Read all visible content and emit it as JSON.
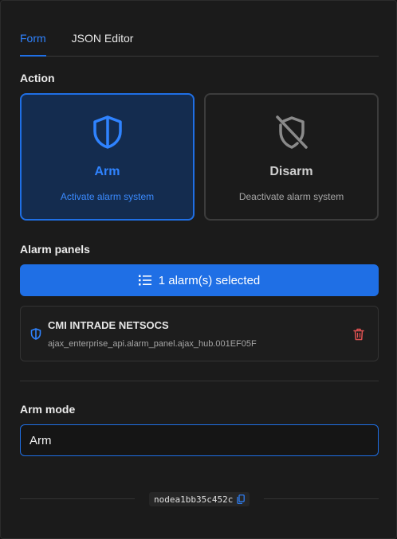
{
  "tabs": [
    {
      "label": "Form",
      "active": true
    },
    {
      "label": "JSON Editor",
      "active": false
    }
  ],
  "action": {
    "label": "Action",
    "arm": {
      "title": "Arm",
      "description": "Activate alarm system",
      "icon": "shield-icon",
      "selected": true
    },
    "disarm": {
      "title": "Disarm",
      "description": "Deactivate alarm system",
      "icon": "shield-off-icon",
      "selected": false
    }
  },
  "alarm_panels": {
    "label": "Alarm panels",
    "selected_button": "1 alarm(s) selected",
    "items": [
      {
        "name": "CMI INTRADE NETSOCS",
        "id": "ajax_enterprise_api.alarm_panel.ajax_hub.001EF05F"
      }
    ]
  },
  "arm_mode": {
    "label": "Arm mode",
    "value": "Arm"
  },
  "footer": {
    "node_id": "nodea1bb35c452c"
  },
  "colors": {
    "accent": "#1f6fe5",
    "danger": "#e05252",
    "background": "#1b1b1b"
  }
}
